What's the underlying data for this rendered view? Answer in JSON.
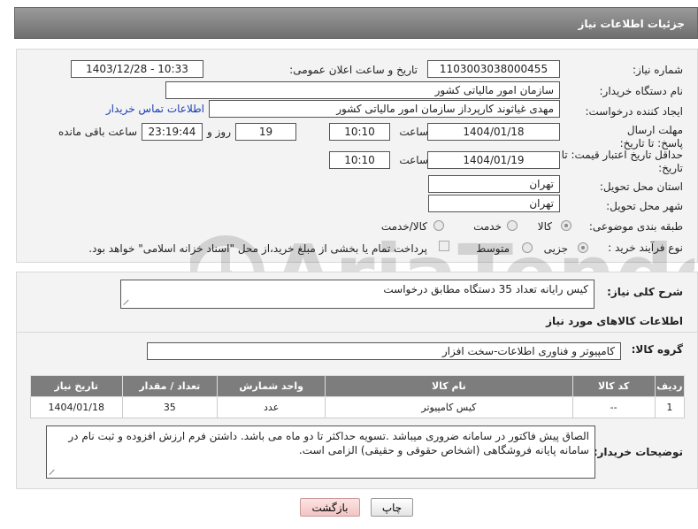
{
  "header": {
    "title": "جزئیات اطلاعات نیاز"
  },
  "fields": {
    "need_number_label": "شماره نیاز:",
    "need_number": "1103003038000455",
    "announce_label": "تاریخ و ساعت اعلان عمومی:",
    "announce_value": "1403/12/28 - 10:33",
    "buyer_org_label": "نام دستگاه خریدار:",
    "buyer_org": "سازمان امور مالیاتی کشور",
    "creator_label": "ایجاد کننده درخواست:",
    "creator": "مهدی غیاثوند کارپرداز سازمان امور مالیاتی کشور",
    "contact_link": "اطلاعات تماس خریدار",
    "reply_deadline_label": "مهلت ارسال پاسخ: تا تاریخ:",
    "reply_date": "1404/01/18",
    "time_label": "ساعت",
    "reply_time": "10:10",
    "days": "19",
    "days_label": "روز و",
    "remaining": "23:19:44",
    "remaining_label": "ساعت باقی مانده",
    "price_validity_label": "حداقل تاریخ اعتبار قیمت: تا تاریخ:",
    "price_date": "1404/01/19",
    "price_time": "10:10",
    "province_label": "استان محل تحویل:",
    "province": "تهران",
    "city_label": "شهر محل تحویل:",
    "city": "تهران",
    "category_label": "طبقه بندی موضوعی:",
    "category_options": [
      "کالا",
      "خدمت",
      "کالا/خدمت"
    ],
    "category_selected": "کالا",
    "process_label": "نوع فرآیند خرید :",
    "process_options": [
      "جزیی",
      "متوسط"
    ],
    "process_selected": "جزیی",
    "payment_note": "پرداخت تمام یا بخشی از مبلغ خرید،از محل \"اسناد خزانه اسلامی\" خواهد بود."
  },
  "description": {
    "label": "شرح کلی نیاز:",
    "value": "کیس رایانه تعداد 35 دستگاه مطابق درخواست",
    "goods_info_title": "اطلاعات کالاهای مورد نیاز",
    "group_label": "گروه کالا:",
    "group_value": "کامپیوتر و فناوری اطلاعات-سخت افزار"
  },
  "table": {
    "headers": [
      "ردیف",
      "کد کالا",
      "نام کالا",
      "واحد شمارش",
      "تعداد / مقدار",
      "تاریخ نیاز"
    ],
    "rows": [
      [
        "1",
        "--",
        "کیس کامپیوتر",
        "عدد",
        "35",
        "1404/01/18"
      ]
    ]
  },
  "buyer_notes": {
    "label": "توضیحات خریدار:",
    "value": "الصاق پیش فاکتور در سامانه ضروری میباشد .تسویه حداکثر تا دو ماه می باشد.  داشتن فرم ارزش افزوده و ثبت نام در سامانه پایانه فروشگاهی (اشخاص حقوقی و حقیقی) الزامی است."
  },
  "buttons": {
    "back": "بازگشت",
    "print": "چاپ"
  },
  "watermark": {
    "text": "AriaTender.net"
  },
  "colors": {
    "header_bg": "#7d7d7d",
    "link": "#1a3fb0",
    "back_button_bg": "#f7d4d4"
  }
}
